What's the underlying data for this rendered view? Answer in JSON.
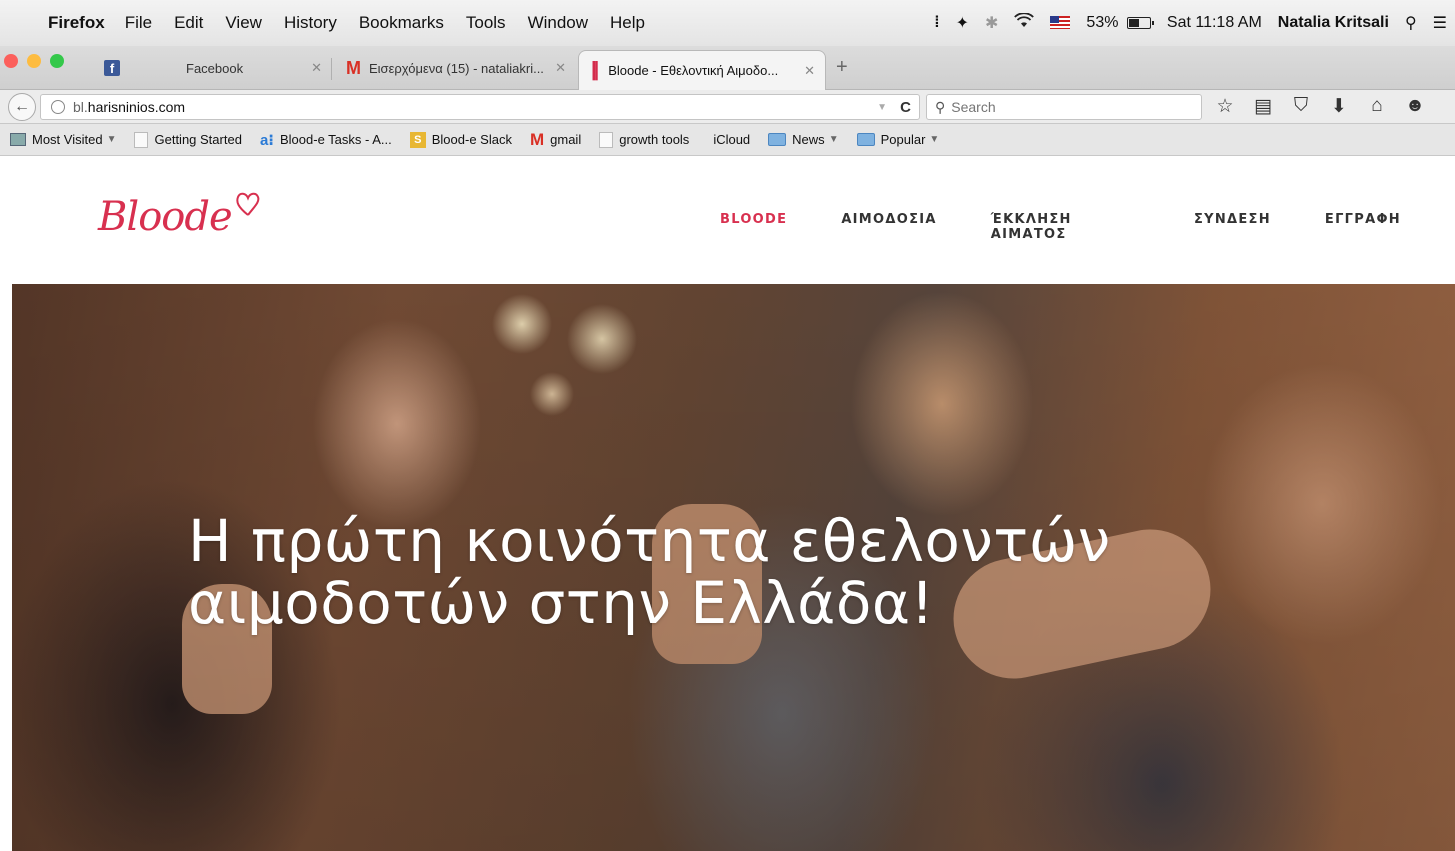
{
  "menubar": {
    "app": "Firefox",
    "items": [
      "File",
      "Edit",
      "View",
      "History",
      "Bookmarks",
      "Tools",
      "Window",
      "Help"
    ],
    "battery": "53%",
    "clock": "Sat 11:18 AM",
    "user": "Natalia Kritsali"
  },
  "tabs": [
    {
      "title": "Facebook"
    },
    {
      "title": "Εισερχόμενα (15) - nataliakri..."
    },
    {
      "title": "Bloode - Εθελοντική Αιμοδο..."
    }
  ],
  "navbar": {
    "url_sub": "bl.",
    "url_host": "harisninios.com",
    "search_placeholder": "Search"
  },
  "bookmarks": [
    {
      "label": "Most Visited"
    },
    {
      "label": "Getting Started"
    },
    {
      "label": "Blood-e Tasks - A..."
    },
    {
      "label": "Blood-e Slack"
    },
    {
      "label": "gmail"
    },
    {
      "label": "growth tools"
    },
    {
      "label": "iCloud"
    },
    {
      "label": "News"
    },
    {
      "label": "Popular"
    }
  ],
  "site": {
    "logo": "Bloode",
    "nav": [
      "BLOODE",
      "ΑΙΜΟΔΟΣΙΑ",
      "ΈΚΚΛΗΣΗ ΑΙΜΑΤΟΣ",
      "ΣΥΝΔΕΣΗ",
      "ΕΓΓΡΑΦΗ"
    ],
    "hero_line1": "Η πρώτη κοινότητα εθελοντών",
    "hero_line2": "αιμοδοτών στην Ελλάδα!"
  },
  "colors": {
    "brand": "#d8304f",
    "traffic_red": "#fc605c",
    "traffic_yellow": "#fdbc40",
    "traffic_green": "#34c84a"
  }
}
